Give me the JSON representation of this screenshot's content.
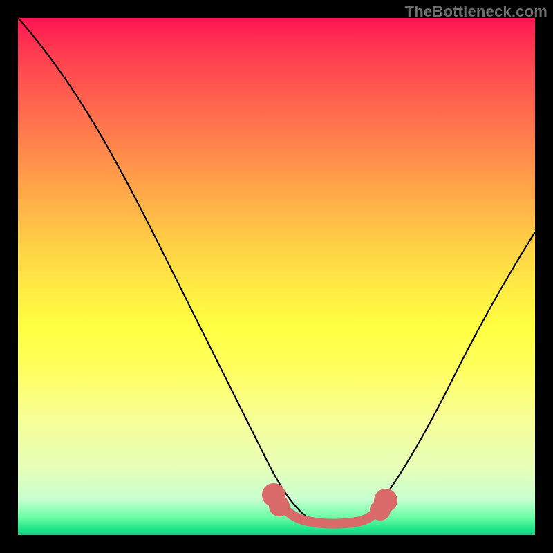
{
  "watermark": "TheBottleneck.com",
  "chart_data": {
    "type": "line",
    "title": "",
    "xlabel": "",
    "ylabel": "",
    "xlim": [
      0,
      100
    ],
    "ylim": [
      0,
      100
    ],
    "grid": false,
    "legend": false,
    "annotations": [],
    "series": [
      {
        "name": "curve",
        "x": [
          0,
          5,
          10,
          15,
          20,
          25,
          30,
          35,
          40,
          45,
          48,
          50,
          52,
          55,
          58,
          61,
          64,
          67,
          70,
          75,
          80,
          85,
          90,
          95,
          100
        ],
        "y": [
          100,
          90,
          80,
          71,
          62,
          53,
          45,
          37,
          29,
          22,
          15,
          9,
          5,
          3,
          2,
          2,
          2,
          3,
          5,
          10,
          18,
          27,
          37,
          48,
          59
        ]
      },
      {
        "name": "marker-band",
        "x": [
          48,
          50,
          52,
          55,
          58,
          60,
          62,
          64,
          66,
          68,
          70
        ],
        "y": [
          8,
          5,
          3,
          2.5,
          2.4,
          2.4,
          2.5,
          2.7,
          3,
          4,
          6
        ]
      }
    ],
    "colors": {
      "curve": "#000000",
      "marker": "#d86a6a"
    }
  }
}
